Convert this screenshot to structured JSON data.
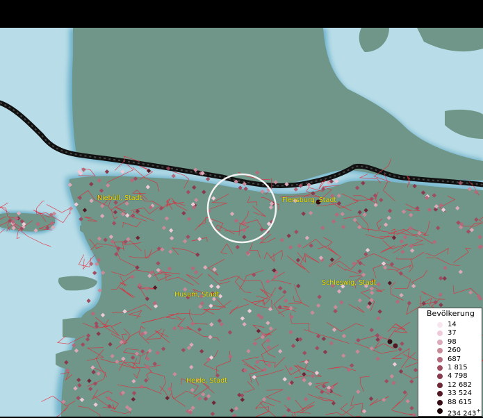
{
  "map": {
    "cities": [
      {
        "name": "Niebüll, Stadt"
      },
      {
        "name": "Flensburg, Stadt"
      },
      {
        "name": "Schleswig, Stadt"
      },
      {
        "name": "Husum, Stadt"
      },
      {
        "name": "Heide, Stadt"
      }
    ]
  },
  "legend": {
    "title": "Bevölkerung",
    "items": [
      {
        "value": "14",
        "color": "#f8e6ee"
      },
      {
        "value": "37",
        "color": "#efcad8"
      },
      {
        "value": "98",
        "color": "#dcaab8"
      },
      {
        "value": "260",
        "color": "#c98a99"
      },
      {
        "value": "687",
        "color": "#b56a7c"
      },
      {
        "value": "1 815",
        "color": "#9f4e62"
      },
      {
        "value": "4 798",
        "color": "#893a4e"
      },
      {
        "value": "12 682",
        "color": "#6f2737"
      },
      {
        "value": "33 524",
        "color": "#521824"
      },
      {
        "value": "88 615",
        "color": "#350b14"
      },
      {
        "value": "234 243",
        "color": "#1a0206",
        "suffix": "+"
      }
    ]
  },
  "colors": {
    "sea": "#bfe0ea",
    "land": "#6e9286",
    "border": "#e8283a"
  }
}
